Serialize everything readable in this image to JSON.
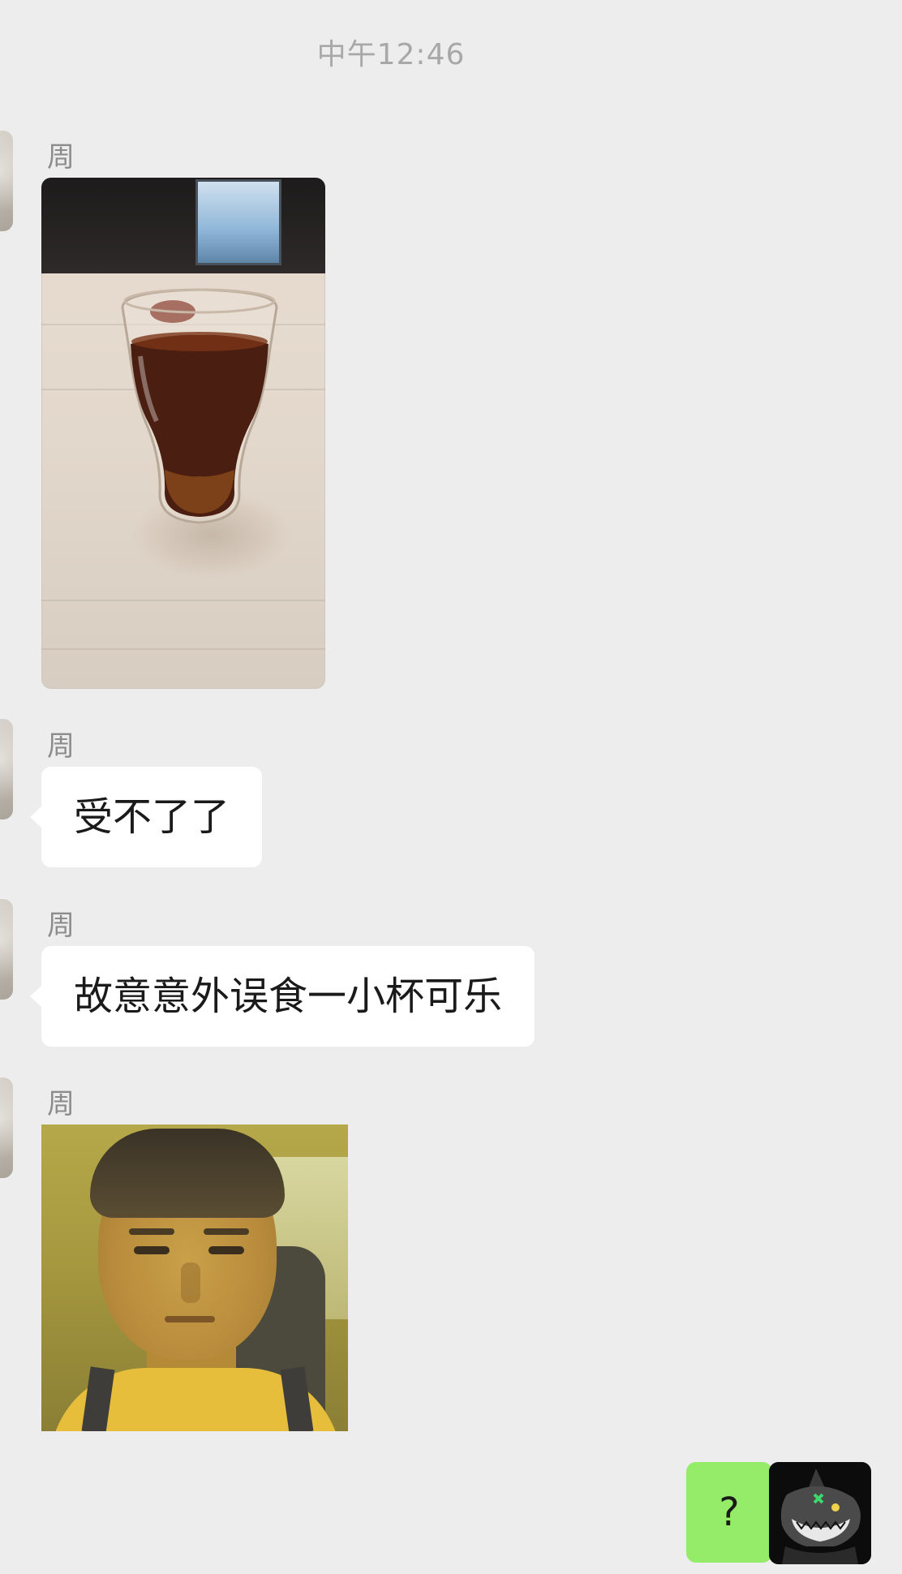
{
  "timestamp": "中午12:46",
  "messages": [
    {
      "sender": "周",
      "type": "image",
      "image_desc": "cola-glass-photo"
    },
    {
      "sender": "周",
      "type": "text",
      "text": "受不了了"
    },
    {
      "sender": "周",
      "type": "text",
      "text": "故意意外误食一小杯可乐"
    },
    {
      "sender": "周",
      "type": "image",
      "image_desc": "selfie-photo"
    },
    {
      "sender": "me",
      "type": "text",
      "text": "?"
    }
  ],
  "colors": {
    "background": "#ededed",
    "incoming_bubble": "#ffffff",
    "outgoing_bubble": "#95ec69",
    "timestamp_text": "#a8a8a8",
    "sender_name": "#8c8c8c"
  },
  "icons": {
    "self_avatar": "black-shark-character-avatar",
    "contact_avatar": "contact-avatar"
  }
}
